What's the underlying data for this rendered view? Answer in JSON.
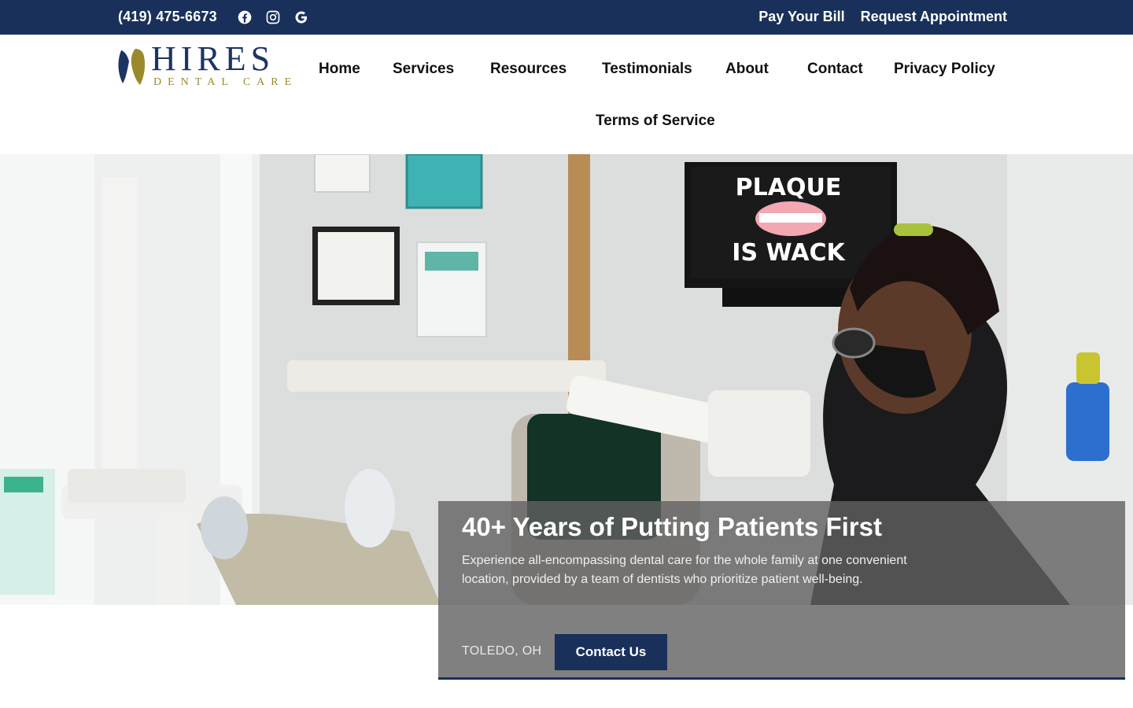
{
  "topbar": {
    "phone": "(419) 475-6673",
    "social": [
      {
        "icon": "facebook-icon"
      },
      {
        "icon": "instagram-icon"
      },
      {
        "icon": "google-icon"
      }
    ],
    "links": [
      "Pay Your Bill",
      "Request Appointment"
    ]
  },
  "logo": {
    "name": "HIRES",
    "tagline": "DENTAL CARE"
  },
  "nav": {
    "items": [
      "Home",
      "Services",
      "Resources",
      "Testimonials",
      "About",
      "Contact",
      "Privacy Policy",
      "Terms of Service"
    ]
  },
  "hero": {
    "tv_text_line1": "PLAQUE",
    "tv_text_line2": "IS WACK",
    "heading": "40+ Years of Putting Patients First",
    "description": "Experience all-encompassing dental care for the whole family at one convenient location, provided by a team of dentists who prioritize patient well-being.",
    "location": "TOLEDO, OH",
    "cta_label": "Contact Us"
  },
  "colors": {
    "brand_navy": "#18305a",
    "logo_gold": "#9a8a2c",
    "card_gray": "#808080"
  }
}
